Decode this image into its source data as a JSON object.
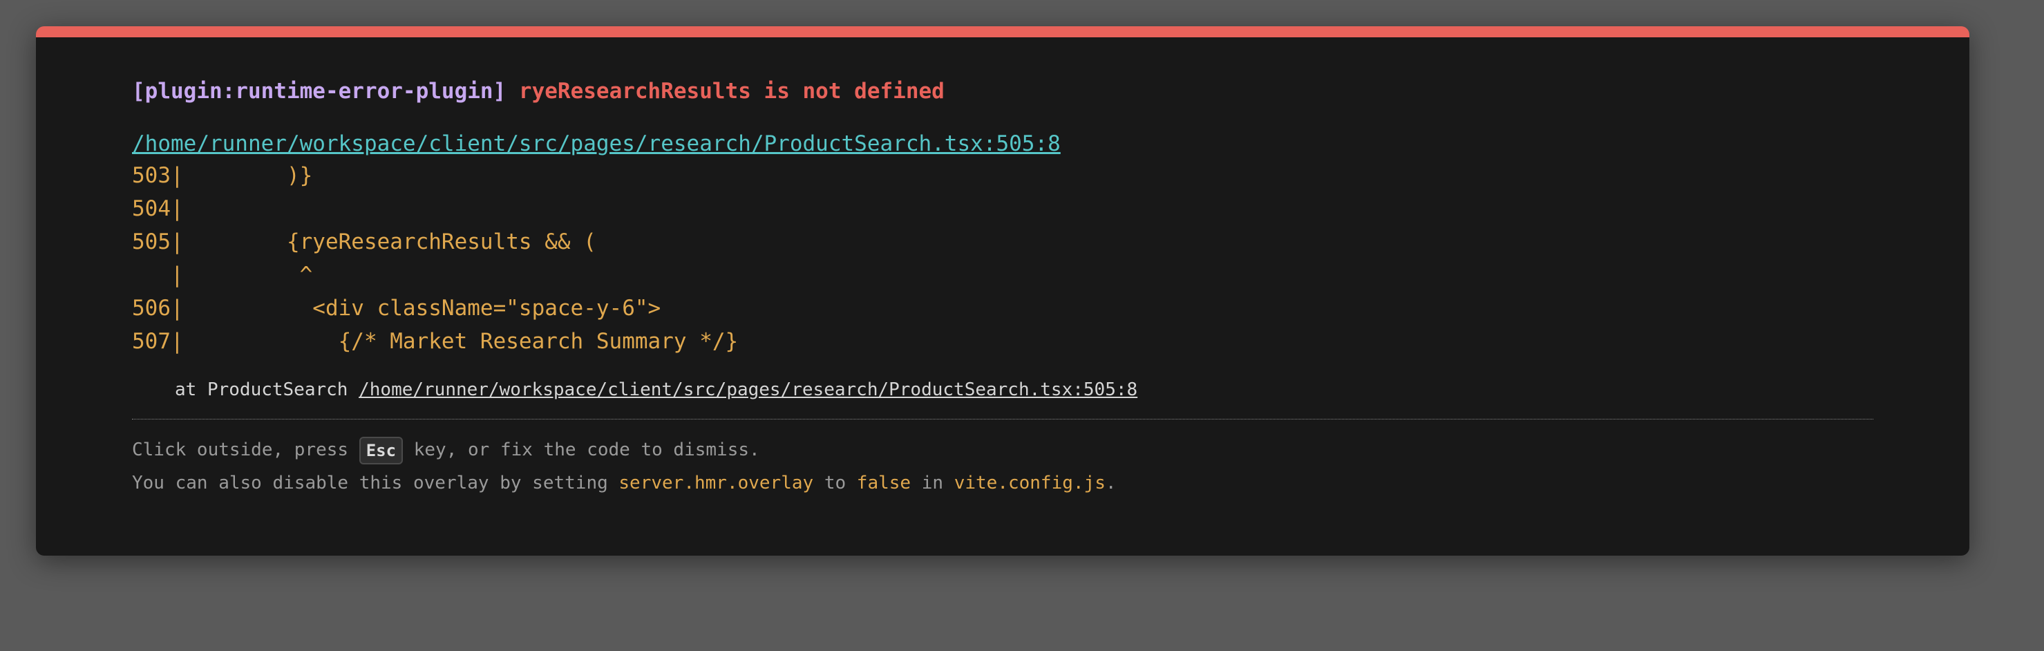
{
  "error": {
    "plugin": "[plugin:runtime-error-plugin]",
    "message": "ryeResearchResults is not defined",
    "file": "/home/runner/workspace/client/src/pages/research/ProductSearch.tsx:505:8"
  },
  "frame": [
    "503|        )}",
    "504|",
    "505|        {ryeResearchResults && (",
    "   |         ^",
    "506|          <div className=\"space-y-6\">",
    "507|            {/* Market Research Summary */}"
  ],
  "stack": {
    "prefix": "at ProductSearch ",
    "file": "/home/runner/workspace/client/src/pages/research/ProductSearch.tsx:505:8"
  },
  "tip": {
    "line1_before": "Click outside, press ",
    "key": "Esc",
    "line1_after": " key, or fix the code to dismiss.",
    "line2_before": "You can also disable this overlay by setting ",
    "setting": "server.hmr.overlay",
    "line2_to": " to ",
    "value": "false",
    "line2_in": " in ",
    "config_file": "vite.config.js",
    "line2_end": "."
  },
  "colors": {
    "accent_bar": "#e8625a",
    "plugin": "#c7a8f0",
    "message": "#e8625a",
    "link": "#56c6c8",
    "code": "#e0a84e"
  }
}
